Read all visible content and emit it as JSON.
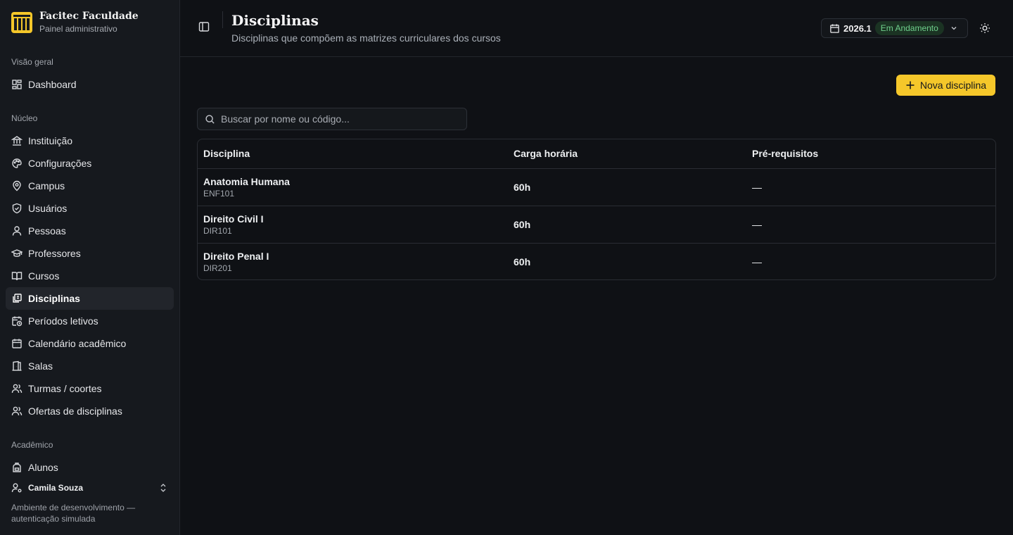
{
  "brand": {
    "name": "Facitec Faculdade",
    "subtitle": "Painel administrativo"
  },
  "sidebar": {
    "sections": {
      "overview": "Visão geral",
      "core": "Núcleo",
      "academic": "Acadêmico"
    },
    "items": [
      {
        "label": "Dashboard",
        "icon": "dashboard-icon"
      },
      {
        "label": "Instituição",
        "icon": "landmark-icon"
      },
      {
        "label": "Configurações",
        "icon": "palette-icon"
      },
      {
        "label": "Campus",
        "icon": "map-pin-icon"
      },
      {
        "label": "Usuários",
        "icon": "shield-icon"
      },
      {
        "label": "Pessoas",
        "icon": "user-icon"
      },
      {
        "label": "Professores",
        "icon": "graduation-cap-icon"
      },
      {
        "label": "Cursos",
        "icon": "book-open-icon"
      },
      {
        "label": "Disciplinas",
        "icon": "library-icon",
        "active": true
      },
      {
        "label": "Períodos letivos",
        "icon": "calendar-clock-icon"
      },
      {
        "label": "Calendário acadêmico",
        "icon": "calendar-icon"
      },
      {
        "label": "Salas",
        "icon": "door-icon"
      },
      {
        "label": "Turmas / coortes",
        "icon": "users-icon"
      },
      {
        "label": "Ofertas de disciplinas",
        "icon": "users-icon"
      },
      {
        "label": "Alunos",
        "icon": "backpack-icon"
      }
    ],
    "user": {
      "name": "Camila Souza"
    },
    "env_note": "Ambiente de desenvolvimento — autenticação simulada"
  },
  "header": {
    "title": "Disciplinas",
    "subtitle": "Disciplinas que compõem as matrizes curriculares dos cursos",
    "period": {
      "year": "2026.1",
      "status": "Em Andamento"
    }
  },
  "actions": {
    "new_label": "Nova disciplina"
  },
  "search": {
    "placeholder": "Buscar por nome ou código...",
    "value": ""
  },
  "table": {
    "columns": [
      "Disciplina",
      "Carga horária",
      "Pré-requisitos"
    ],
    "rows": [
      {
        "name": "Anatomia Humana",
        "code": "ENF101",
        "hours": "60h",
        "prereq": "—"
      },
      {
        "name": "Direito Civil I",
        "code": "DIR101",
        "hours": "60h",
        "prereq": "—"
      },
      {
        "name": "Direito Penal I",
        "code": "DIR201",
        "hours": "60h",
        "prereq": "—"
      }
    ]
  },
  "colors": {
    "accent": "#f5c72a",
    "status_green": "#6fd08c",
    "background": "#0f1115",
    "sidebar": "#16191e"
  }
}
